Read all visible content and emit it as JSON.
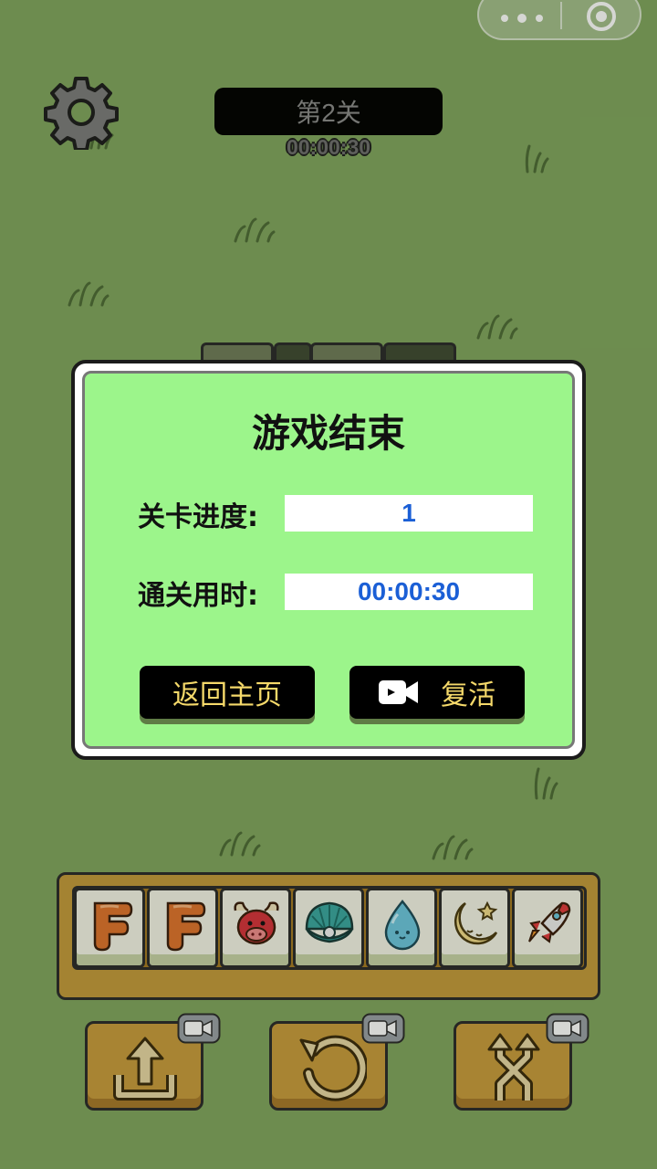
{
  "level": {
    "title": "第2关",
    "timer": "00:00:30"
  },
  "modal": {
    "title": "游戏结束",
    "progress_label": "关卡进度:",
    "progress_value": "1",
    "time_label": "通关用时:",
    "time_value": "00:00:30",
    "home_button": "返回主页",
    "revive_button": "复活"
  },
  "tray": {
    "tiles": [
      {
        "icon": "letter-f-icon"
      },
      {
        "icon": "letter-f-icon"
      },
      {
        "icon": "bull-icon"
      },
      {
        "icon": "shell-pearl-icon"
      },
      {
        "icon": "water-drop-icon"
      },
      {
        "icon": "moon-star-icon"
      },
      {
        "icon": "rocket-icon"
      }
    ]
  },
  "powerups": [
    {
      "icon": "move-out-icon",
      "badge": "video-icon"
    },
    {
      "icon": "undo-icon",
      "badge": "video-icon"
    },
    {
      "icon": "shuffle-icon",
      "badge": "video-icon"
    }
  ],
  "colors": {
    "background": "#80a55e",
    "modal": "#9cf58b",
    "accent_text": "#f5d96a",
    "value_text": "#1b5fd6",
    "tray": "#c49a3b"
  }
}
